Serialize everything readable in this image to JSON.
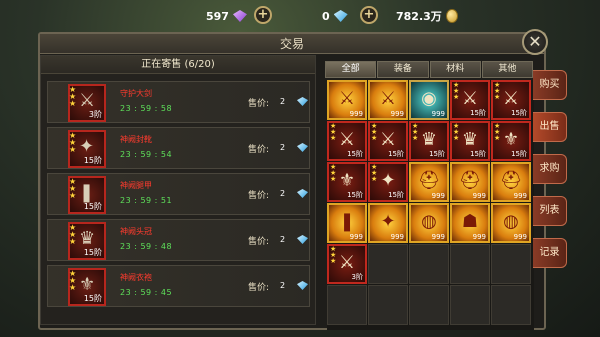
{
  "topbar": {
    "purple_gems": "597",
    "blue_gems": "0",
    "gold": "782.3万",
    "plus_symbol": "+"
  },
  "window": {
    "title": "交易",
    "close_symbol": "✕"
  },
  "listing": {
    "header": "正在寄售 (6/20)",
    "rows": [
      {
        "name": "守护大剑",
        "time": "23 : 59 : 58",
        "price_label": "售价:",
        "price": "2",
        "level": "3阶",
        "glyph": "⚔"
      },
      {
        "name": "神阙封靴",
        "time": "23 : 59 : 54",
        "price_label": "售价:",
        "price": "2",
        "level": "15阶",
        "glyph": "✦"
      },
      {
        "name": "神阙腿甲",
        "time": "23 : 59 : 51",
        "price_label": "售价:",
        "price": "2",
        "level": "15阶",
        "glyph": "❚"
      },
      {
        "name": "神阙头冠",
        "time": "23 : 59 : 48",
        "price_label": "售价:",
        "price": "2",
        "level": "15阶",
        "glyph": "♛"
      },
      {
        "name": "神阙衣袍",
        "time": "23 : 59 : 45",
        "price_label": "售价:",
        "price": "2",
        "level": "15阶",
        "glyph": "⚜"
      }
    ]
  },
  "tabs": [
    "全部",
    "装备",
    "材料",
    "其他"
  ],
  "active_tab": 0,
  "side_buttons": [
    "购买",
    "出售",
    "求购",
    "列表",
    "记录"
  ],
  "active_side_button": 1,
  "inventory": [
    {
      "style": "gold",
      "glyph": "⚔",
      "qty": "999",
      "stars": false
    },
    {
      "style": "gold",
      "glyph": "⚔",
      "qty": "999",
      "stars": false
    },
    {
      "style": "cyan",
      "glyph": "◉",
      "qty": "999",
      "stars": false
    },
    {
      "style": "red",
      "glyph": "⚔",
      "qty": "15阶",
      "stars": true
    },
    {
      "style": "red",
      "glyph": "⚔",
      "qty": "15阶",
      "stars": true
    },
    {
      "style": "red",
      "glyph": "⚔",
      "qty": "15阶",
      "stars": true
    },
    {
      "style": "red",
      "glyph": "⚔",
      "qty": "15阶",
      "stars": true
    },
    {
      "style": "red",
      "glyph": "♛",
      "qty": "15阶",
      "stars": true
    },
    {
      "style": "red",
      "glyph": "♛",
      "qty": "15阶",
      "stars": true
    },
    {
      "style": "red",
      "glyph": "⚜",
      "qty": "15阶",
      "stars": true
    },
    {
      "style": "red",
      "glyph": "⚜",
      "qty": "15阶",
      "stars": true
    },
    {
      "style": "red",
      "glyph": "✦",
      "qty": "15阶",
      "stars": true
    },
    {
      "style": "gold",
      "glyph": "⛑",
      "qty": "999",
      "stars": false
    },
    {
      "style": "gold",
      "glyph": "⛑",
      "qty": "999",
      "stars": false
    },
    {
      "style": "gold",
      "glyph": "⛑",
      "qty": "999",
      "stars": false
    },
    {
      "style": "gold",
      "glyph": "❚",
      "qty": "999",
      "stars": false
    },
    {
      "style": "gold",
      "glyph": "✦",
      "qty": "999",
      "stars": false
    },
    {
      "style": "gold",
      "glyph": "◍",
      "qty": "999",
      "stars": false
    },
    {
      "style": "gold",
      "glyph": "☗",
      "qty": "999",
      "stars": false
    },
    {
      "style": "gold",
      "glyph": "◍",
      "qty": "999",
      "stars": false
    },
    {
      "style": "red",
      "glyph": "⚔",
      "qty": "3阶",
      "stars": true
    },
    {
      "style": "empty"
    },
    {
      "style": "empty"
    },
    {
      "style": "empty"
    },
    {
      "style": "empty"
    },
    {
      "style": "empty"
    },
    {
      "style": "empty"
    },
    {
      "style": "empty"
    },
    {
      "style": "empty"
    },
    {
      "style": "empty"
    }
  ]
}
